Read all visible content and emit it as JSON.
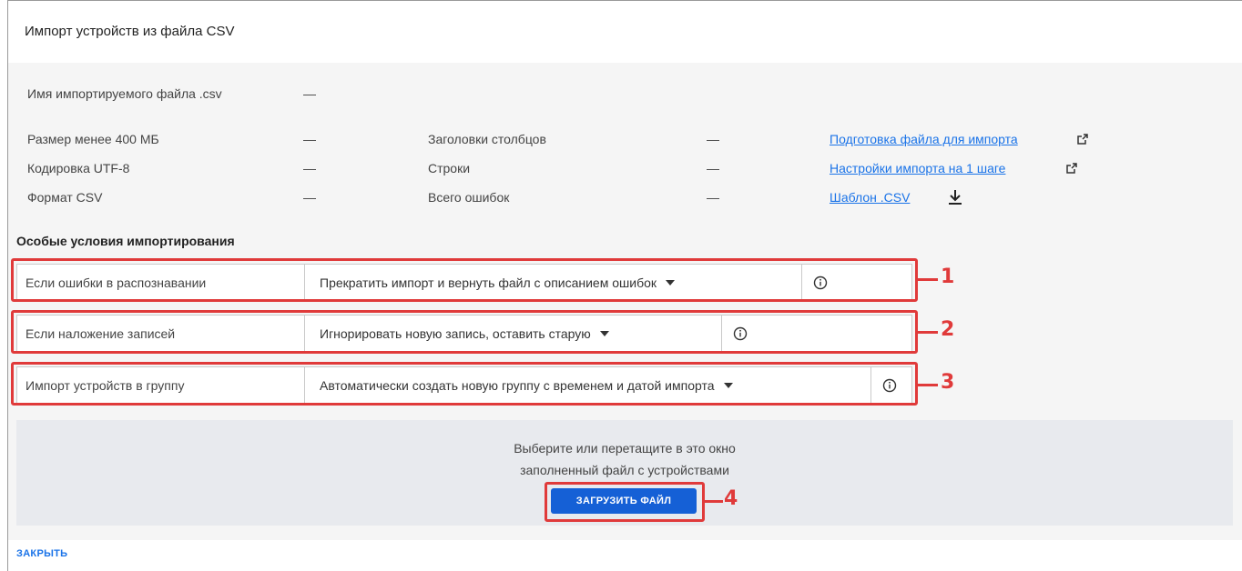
{
  "dialog": {
    "title": "Импорт устройств из файла CSV"
  },
  "file_name": {
    "label": "Имя импортируемого файла .csv",
    "value": "—"
  },
  "checks": [
    {
      "label": "Размер менее 400 МБ",
      "value": "—"
    },
    {
      "label": "Кодировка UTF-8",
      "value": "—"
    },
    {
      "label": "Формат CSV",
      "value": "—"
    }
  ],
  "stats": [
    {
      "label": "Заголовки столбцов",
      "value": "—"
    },
    {
      "label": "Строки",
      "value": "—"
    },
    {
      "label": "Всего ошибок",
      "value": "—"
    }
  ],
  "links": [
    {
      "label": "Подготовка файла для импорта",
      "icon": "external-link-icon"
    },
    {
      "label": "Настройки импорта на 1 шаге",
      "icon": "external-link-icon"
    },
    {
      "label": "Шаблон .CSV",
      "icon": "download-icon"
    }
  ],
  "special_conditions": {
    "title": "Особые условия импортирования",
    "rows": [
      {
        "label": "Если ошибки в распознавании",
        "selected": "Прекратить импорт и вернуть файл с описанием ошибок",
        "callout": "1"
      },
      {
        "label": "Если наложение записей",
        "selected": "Игнорировать новую запись, оставить старую",
        "callout": "2"
      },
      {
        "label": "Импорт устройств в группу",
        "selected": "Автоматически создать новую группу с временем и датой импорта",
        "callout": "3"
      }
    ]
  },
  "dropzone": {
    "line1": "Выберите или перетащите в это окно",
    "line2": "заполненный файл с устройствами",
    "button": "ЗАГРУЗИТЬ ФАЙЛ",
    "callout": "4"
  },
  "footer": {
    "close_label": "ЗАКРЫТЬ"
  },
  "colors": {
    "accent": "#1560d6",
    "link": "#1a73e8",
    "callout": "#e03a3a",
    "body_bg": "#f5f5f5"
  }
}
